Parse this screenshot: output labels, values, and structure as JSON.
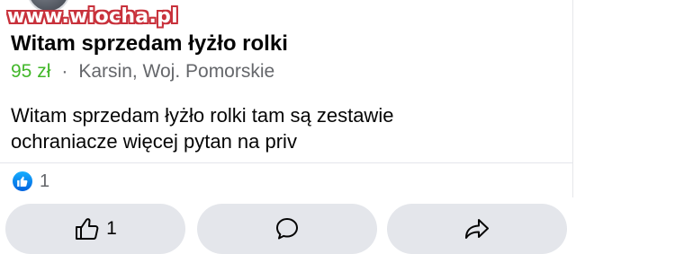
{
  "watermark": "www.wiocha.pl",
  "listing": {
    "title": "Witam sprzedam łyżło rolki",
    "price": "95 zł",
    "separator": "·",
    "location": "Karsin, Woj. Pomorskie",
    "description_line1": "Witam sprzedam łyżło rolki tam są zestawie",
    "description_line2": "ochraniacze więcej pytan na priv"
  },
  "reactions": {
    "icon": "like-icon",
    "count": "1"
  },
  "actions": {
    "like_icon": "thumbs-up-icon",
    "like_count": "1",
    "comment_icon": "comment-icon",
    "share_icon": "share-icon"
  },
  "colors": {
    "price": "#42b72a",
    "meta": "#65676b",
    "button_bg": "#e4e6eb",
    "watermark_red": "#c8313b",
    "like_blue": "#0062df"
  }
}
